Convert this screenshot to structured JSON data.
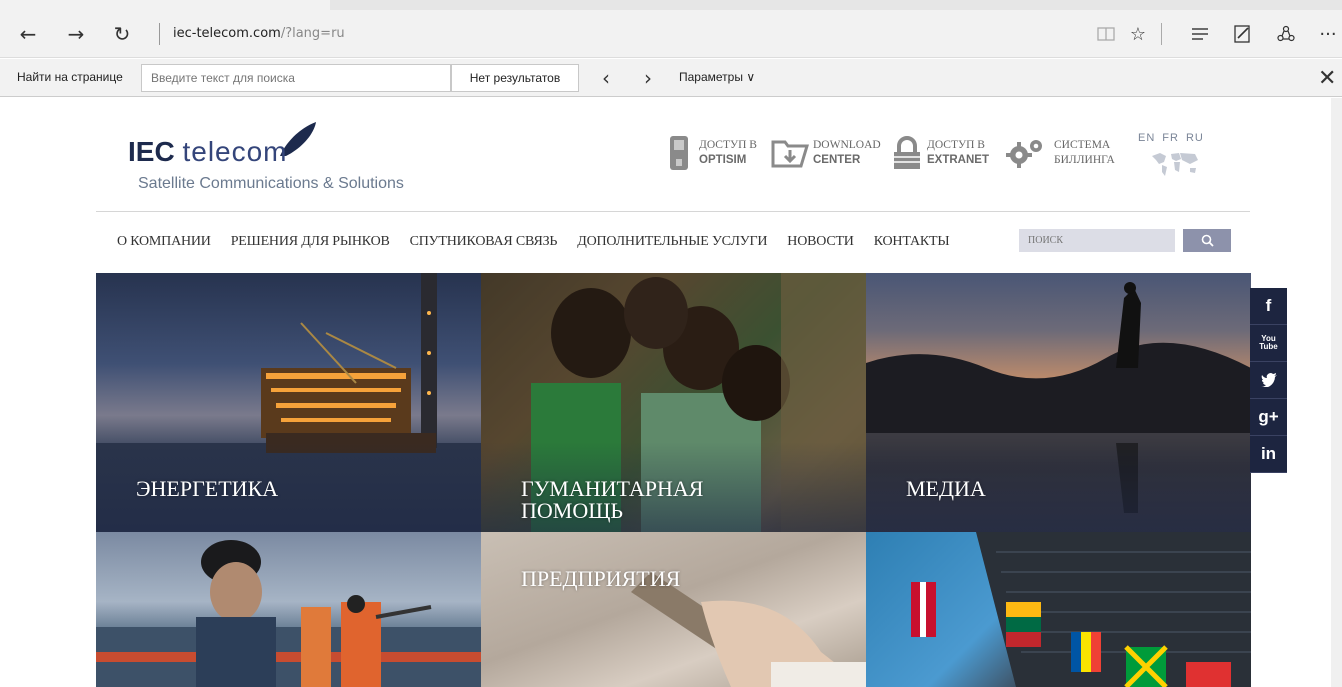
{
  "browser": {
    "url_host": "iec-telecom.com",
    "url_rest": "/?lang=ru"
  },
  "findbar": {
    "label": "Найти на странице",
    "placeholder": "Введите текст для поиска",
    "results": "Нет результатов",
    "params": "Параметры"
  },
  "logo": {
    "brand_bold": "IEC",
    "brand_light": "telecom",
    "tagline": "Satellite Communications & Solutions"
  },
  "header_links": [
    {
      "line1": "ДОСТУП В",
      "line2": "OPTISIM"
    },
    {
      "line1": "DOWNLOAD",
      "line2": "CENTER"
    },
    {
      "line1": "ДОСТУП В",
      "line2": "EXTRANET"
    },
    {
      "line1": "СИСТЕМА",
      "line2": "БИЛЛИНГА"
    }
  ],
  "langs": [
    "EN",
    "FR",
    "RU"
  ],
  "menu": [
    "О КОМПАНИИ",
    "РЕШЕНИЯ ДЛЯ РЫНКОВ",
    "СПУТНИКОВАЯ СВЯЗЬ",
    "ДОПОЛНИТЕЛЬНЫЕ УСЛУГИ",
    "НОВОСТИ",
    "КОНТАКТЫ"
  ],
  "search": {
    "placeholder": "ПОИСК"
  },
  "tiles": [
    {
      "label": "ЭНЕРГЕТИКА"
    },
    {
      "label_l1": "ГУМАНИТАРНАЯ",
      "label_l2": "ПОМОЩЬ"
    },
    {
      "label": "МЕДИА"
    },
    {
      "label": "ПРЕДПРИЯТИЯ"
    }
  ],
  "social": {
    "facebook": "f",
    "youtube_l1": "You",
    "youtube_l2": "Tube",
    "googleplus": "g+",
    "linkedin": "in"
  },
  "colors": {
    "navy": "#1d2540",
    "search_btn": "#8d92ab",
    "search_bg": "#dcdde6"
  }
}
